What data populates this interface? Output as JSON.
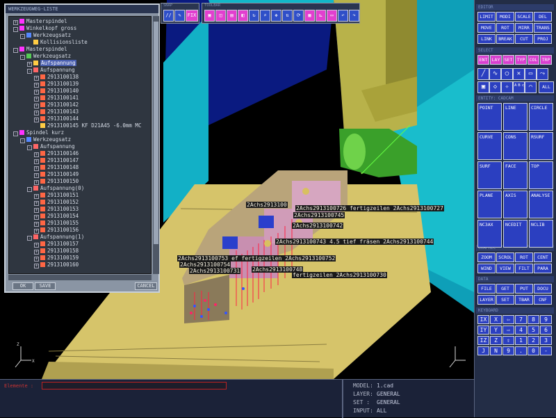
{
  "tree": {
    "title": "WERKZEUGWEG-LISTE",
    "rows": [
      {
        "label": "Masterspindel",
        "indent": 0,
        "icon": "#f3f",
        "toggle": "+"
      },
      {
        "label": "Winkelkopf gross",
        "indent": 0,
        "icon": "#f3f",
        "toggle": "-"
      },
      {
        "label": "Werkzeugsatz",
        "indent": 1,
        "icon": "#58f",
        "toggle": "-"
      },
      {
        "label": "Kollisionsliste",
        "indent": 2,
        "icon": "#fc4",
        "toggle": ""
      },
      {
        "label": "Masterspindel",
        "indent": 0,
        "icon": "#f3f",
        "toggle": "-"
      },
      {
        "label": "Werkzeugsatz",
        "indent": 1,
        "icon": "#5c5",
        "toggle": "-"
      },
      {
        "label": "Aufspannung",
        "indent": 2,
        "icon": "#fc4",
        "toggle": "+",
        "selected": true
      },
      {
        "label": "Aufspannung",
        "indent": 2,
        "icon": "#f66",
        "toggle": "-"
      },
      {
        "label": "2913100138",
        "indent": 3,
        "icon": "#f64",
        "toggle": "+"
      },
      {
        "label": "2913100139",
        "indent": 3,
        "icon": "#f64",
        "toggle": "+"
      },
      {
        "label": "2913100140",
        "indent": 3,
        "icon": "#f64",
        "toggle": "+"
      },
      {
        "label": "2913100141",
        "indent": 3,
        "icon": "#f64",
        "toggle": "+"
      },
      {
        "label": "2913100142",
        "indent": 3,
        "icon": "#f64",
        "toggle": "+"
      },
      {
        "label": "2913100143",
        "indent": 3,
        "icon": "#f64",
        "toggle": "+"
      },
      {
        "label": "2913100144",
        "indent": 3,
        "icon": "#f64",
        "toggle": "+"
      },
      {
        "label": "2913100145 KF D21A45 -6.0mm MC",
        "indent": 3,
        "icon": "#fc4",
        "toggle": ""
      },
      {
        "label": "Spindel kurz",
        "indent": 0,
        "icon": "#f3f",
        "toggle": "-"
      },
      {
        "label": "Werkzeugsatz",
        "indent": 1,
        "icon": "#58f",
        "toggle": "-"
      },
      {
        "label": "Aufspannung",
        "indent": 2,
        "icon": "#f66",
        "toggle": "-"
      },
      {
        "label": "2913100146",
        "indent": 3,
        "icon": "#f64",
        "toggle": "+"
      },
      {
        "label": "2913100147",
        "indent": 3,
        "icon": "#f64",
        "toggle": "+"
      },
      {
        "label": "2913100148",
        "indent": 3,
        "icon": "#f64",
        "toggle": "+"
      },
      {
        "label": "2913100149",
        "indent": 3,
        "icon": "#f64",
        "toggle": "+"
      },
      {
        "label": "2913100150",
        "indent": 3,
        "icon": "#f64",
        "toggle": "+"
      },
      {
        "label": "Aufspannung(0)",
        "indent": 2,
        "icon": "#f66",
        "toggle": "-"
      },
      {
        "label": "2913100151",
        "indent": 3,
        "icon": "#f64",
        "toggle": "+"
      },
      {
        "label": "2913100152",
        "indent": 3,
        "icon": "#f64",
        "toggle": "+"
      },
      {
        "label": "2913100153",
        "indent": 3,
        "icon": "#f64",
        "toggle": "+"
      },
      {
        "label": "2913100154",
        "indent": 3,
        "icon": "#f64",
        "toggle": "+"
      },
      {
        "label": "2913100155",
        "indent": 3,
        "icon": "#f64",
        "toggle": "+"
      },
      {
        "label": "2913100156",
        "indent": 3,
        "icon": "#f64",
        "toggle": "+"
      },
      {
        "label": "Aufspannung(1)",
        "indent": 2,
        "icon": "#f66",
        "toggle": "-"
      },
      {
        "label": "2913100157",
        "indent": 3,
        "icon": "#f64",
        "toggle": "+"
      },
      {
        "label": "2913100158",
        "indent": 3,
        "icon": "#f64",
        "toggle": "+"
      },
      {
        "label": "2913100159",
        "indent": 3,
        "icon": "#f64",
        "toggle": "+"
      },
      {
        "label": "2913100160",
        "indent": 3,
        "icon": "#f64",
        "toggle": "+"
      }
    ],
    "buttons": {
      "ok": "OK",
      "save": "SAVE",
      "cancel": "CANCEL"
    }
  },
  "toolbars": {
    "left_title": "SNAP",
    "right_title": "TOOLBAR",
    "fix_label": "FIX"
  },
  "panel": {
    "editor_title": "EDITOR",
    "editor_buttons": [
      "LIMIT",
      "MODI",
      "SCALE",
      "DEL",
      "MOVE",
      "ROT",
      "MIRR",
      "TRANS",
      "LINK",
      "BREAK",
      "CUT",
      "PROJ"
    ],
    "select_title": "SELECT",
    "select_buttons": [
      "ENT",
      "LAY",
      "SET",
      "TYP",
      "COL",
      "TRP"
    ],
    "all_label": "ALL",
    "entity_title": "ENTITY: CADCAM",
    "entity_buttons": [
      "POINT",
      "LINE",
      "CIRCLE",
      "CURVE",
      "CONS",
      "RSURF",
      "SURF",
      "FACE",
      "TOP",
      "PLANE",
      "AXIS",
      "ANALYSE",
      "NC3AX",
      "NCEDIT",
      "NCLIB"
    ],
    "graphic_title": "GRAPHIC",
    "graphic_buttons": [
      "ZOOM",
      "SCROL",
      "ROT",
      "CENT",
      "WIND",
      "VIEW",
      "FILT",
      "PARA"
    ],
    "data_title": "DATA",
    "data_buttons": [
      "FILE",
      "GET",
      "PUT",
      "DOCU",
      "LAYER",
      "SET",
      "TBAR",
      "CNF"
    ],
    "keyboard_title": "KEYBOARD",
    "keys": [
      "IX",
      "X",
      "⇦",
      "7",
      "8",
      "9",
      "IY",
      "Y",
      "⇨",
      "4",
      "5",
      "6",
      "IZ",
      "Z",
      "⇧",
      "1",
      "2",
      "3",
      "J",
      "N",
      "9",
      ".",
      "0",
      "-"
    ]
  },
  "bottom": {
    "cmd_label": "Elemente :",
    "cmd_value": "",
    "model_label": "MODEL:",
    "model_value": "1.cad",
    "layer_label": "LAYER:",
    "layer_value": "GENERAL",
    "set_label": "SET  :",
    "set_value": "GENERAL",
    "input_label": "INPUT:",
    "input_value": "ALL"
  },
  "scene_labels": [
    "2Achs2913100",
    "2Achs2913100726 fertigzeilen 2Achs2913100727",
    "2Achs2913100745",
    "2Achs2913100742",
    "2Achs2913100743 4.5 tief fräsen 2Achs2913100744",
    "2Achs2913100753 ef fertigzeilen 2Achs2913100752",
    "2Achs2913100754",
    "2Achs2913100731",
    "2Achs2913100748",
    "fertigzeilen 2Achs2913100730"
  ]
}
